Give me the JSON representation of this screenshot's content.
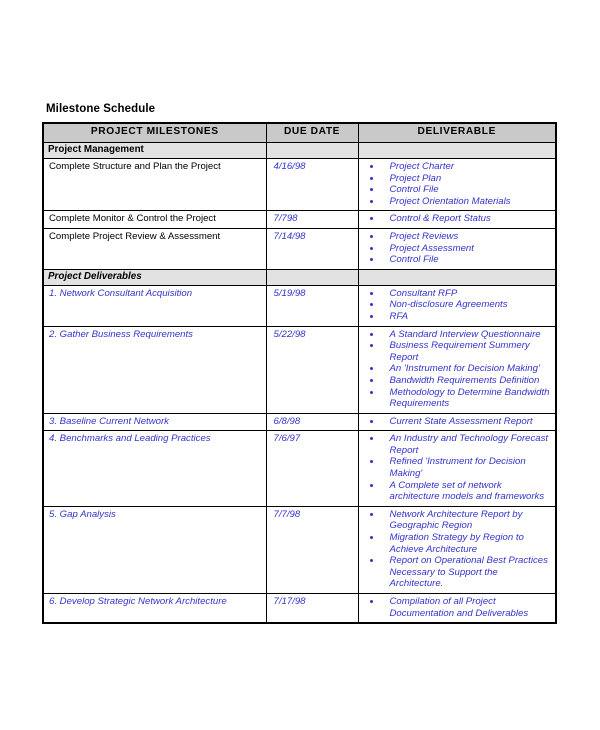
{
  "document": {
    "title": "Milestone Schedule",
    "accent_blue": "#3333CC",
    "header_bg": "#C9C9C9",
    "section_bg": "#E2E2E2",
    "border_color": "#000000"
  },
  "table": {
    "columns": [
      {
        "key": "milestone",
        "label": "PROJECT MILESTONES"
      },
      {
        "key": "due_date",
        "label": "DUE DATE"
      },
      {
        "key": "deliverable",
        "label": "DELIVERABLE"
      }
    ],
    "sections": [
      {
        "title": "Project Management",
        "italic": false,
        "rows": [
          {
            "milestone": "Complete Structure and Plan the Project",
            "milestone_blue": false,
            "due_date": "4/16/98",
            "deliverables": [
              "Project Charter",
              "Project Plan",
              "Control File",
              "Project Orientation Materials"
            ]
          },
          {
            "milestone": "Complete Monitor & Control the Project",
            "milestone_blue": false,
            "due_date": "7/798",
            "deliverables": [
              "Control & Report Status"
            ]
          },
          {
            "milestone": "Complete Project Review & Assessment",
            "milestone_blue": false,
            "due_date": "7/14/98",
            "deliverables": [
              "Project Reviews",
              "Project Assessment",
              "Control File"
            ]
          }
        ]
      },
      {
        "title": "Project Deliverables",
        "italic": true,
        "rows": [
          {
            "milestone": "1.  Network Consultant Acquisition",
            "milestone_blue": true,
            "due_date": "5/19/98",
            "deliverables": [
              "Consultant RFP",
              "Non-disclosure Agreements",
              "RFA"
            ]
          },
          {
            "milestone": "2.  Gather Business Requirements",
            "milestone_blue": true,
            "due_date": "5/22/98",
            "deliverables": [
              "A Standard Interview Questionnaire",
              "Business Requirement Summery Report",
              "An 'Instrument for Decision Making'",
              "Bandwidth Requirements Definition",
              "Methodology to Determine Bandwidth Requirements"
            ]
          },
          {
            "milestone": "3.  Baseline Current Network",
            "milestone_blue": true,
            "due_date": "6/8/98",
            "deliverables": [
              "Current State Assessment Report"
            ]
          },
          {
            "milestone": "4.  Benchmarks and Leading Practices",
            "milestone_blue": true,
            "due_date": "7/6/97",
            "deliverables": [
              "An Industry and Technology Forecast Report",
              "Refined 'Instrument for Decision Making'",
              "A Complete set of network architecture models and frameworks"
            ]
          },
          {
            "milestone": "5.  Gap Analysis",
            "milestone_blue": true,
            "due_date": "7/7/98",
            "deliverables": [
              "Network Architecture Report by Geographic Region",
              "Migration Strategy by Region to Achieve Architecture",
              "Report on Operational Best Practices Necessary to Support the Architecture."
            ]
          },
          {
            "milestone": "6.  Develop Strategic Network Architecture",
            "milestone_blue": true,
            "due_date": "7/17/98",
            "deliverables": [
              "Compilation of all Project Documentation and Deliverables"
            ]
          }
        ]
      }
    ]
  }
}
